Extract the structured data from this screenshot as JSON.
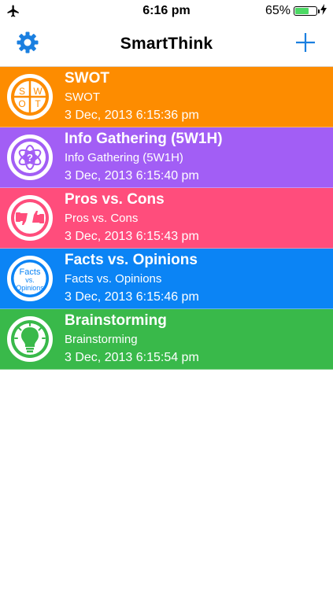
{
  "status_bar": {
    "time": "6:16 pm",
    "battery_percent": "65%",
    "battery_level": 0.65
  },
  "nav": {
    "title": "SmartThink"
  },
  "colors": {
    "accent": "#1a7fe0"
  },
  "items": [
    {
      "title": "SWOT",
      "subtitle": "SWOT",
      "date": "3 Dec, 2013 6:15:36 pm",
      "color": "#fd8c00",
      "icon": "swot-icon",
      "icon_letters": [
        "S",
        "W",
        "O",
        "T"
      ]
    },
    {
      "title": "Info Gathering (5W1H)",
      "subtitle": "Info Gathering (5W1H)",
      "date": "3 Dec, 2013 6:15:40 pm",
      "color": "#a25ef5",
      "icon": "question-flower-icon",
      "icon_text": "?"
    },
    {
      "title": "Pros vs. Cons",
      "subtitle": "Pros vs. Cons",
      "date": "3 Dec, 2013 6:15:43 pm",
      "color": "#ff4d7c",
      "icon": "thumbs-icon"
    },
    {
      "title": "Facts vs. Opinions",
      "subtitle": "Facts vs. Opinions",
      "date": "3 Dec, 2013 6:15:46 pm",
      "color": "#0b84f5",
      "icon": "facts-opinions-icon",
      "icon_lines": [
        "Facts",
        "vs.",
        "Opinions"
      ]
    },
    {
      "title": "Brainstorming",
      "subtitle": "Brainstorming",
      "date": "3 Dec, 2013 6:15:54 pm",
      "color": "#39b94a",
      "icon": "lightbulb-icon"
    }
  ]
}
